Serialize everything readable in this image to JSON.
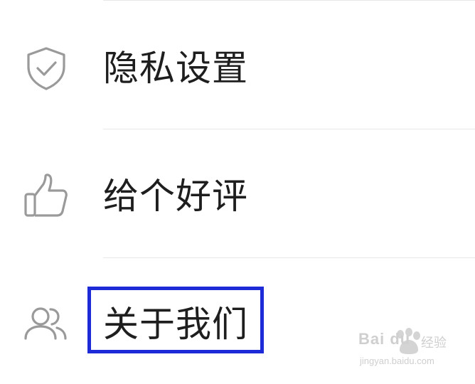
{
  "menu": {
    "items": [
      {
        "label": "隐私设置",
        "icon": "shield-check-icon"
      },
      {
        "label": "给个好评",
        "icon": "thumbs-up-icon"
      },
      {
        "label": "关于我们",
        "icon": "users-icon"
      }
    ]
  },
  "highlight": {
    "target": "关于我们",
    "color": "#1c2ad8"
  },
  "watermark": {
    "brand": "Bai du",
    "suffix": "经验",
    "url": "jingyan.baidu.com"
  },
  "colors": {
    "text": "#1e1e1e",
    "icon": "#9a9a9a",
    "divider": "#e8e8e8",
    "highlight": "#1c2ad8"
  }
}
